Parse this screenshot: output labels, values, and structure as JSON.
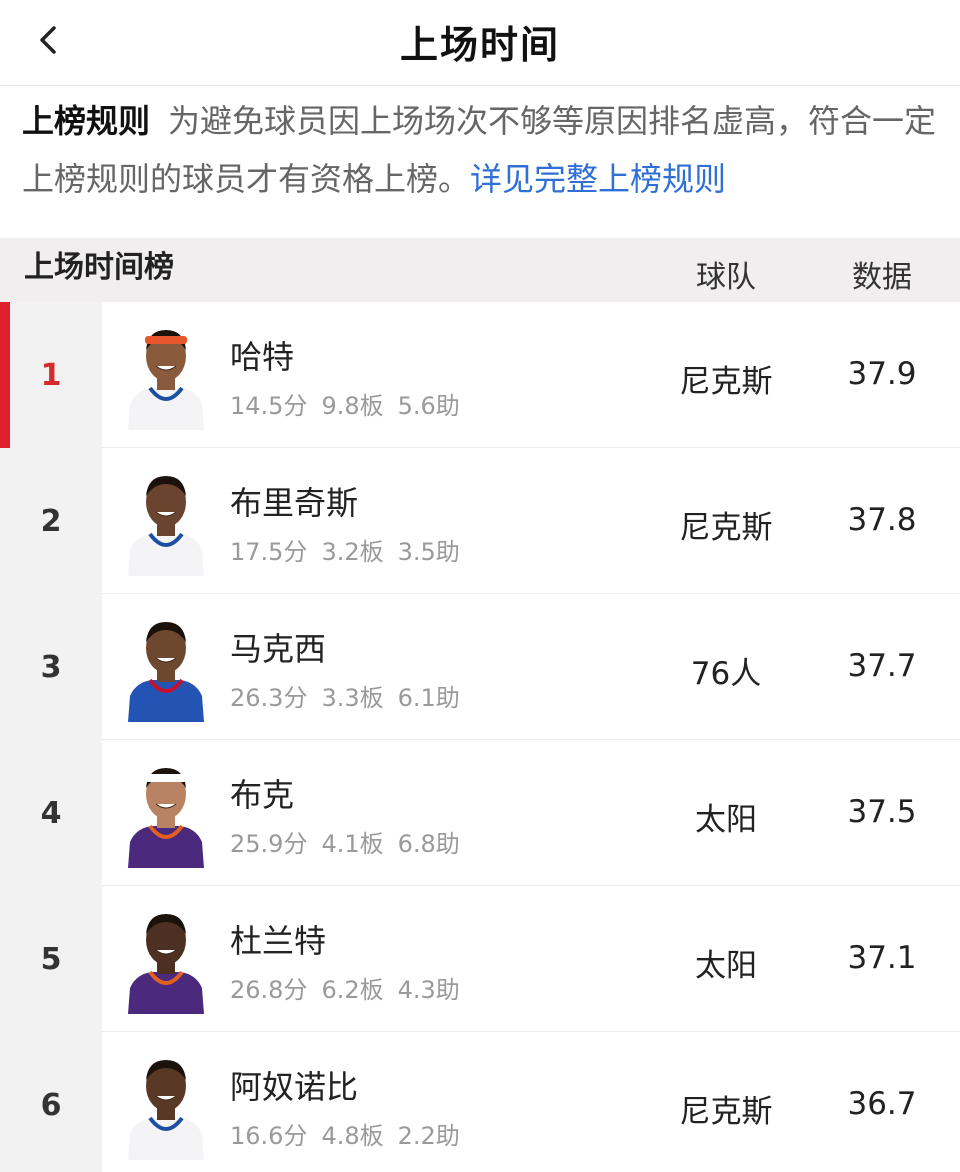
{
  "nav": {
    "title": "上场时间",
    "back_icon": "chevron-left-icon"
  },
  "rules": {
    "heading": "上榜规则",
    "text": "为避免球员因上场场次不够等原因排名虚高，符合一定上榜规则的球员才有资格上榜。",
    "link": "详见完整上榜规则"
  },
  "board": {
    "title": "上场时间榜",
    "col_team": "球队",
    "col_data": "数据"
  },
  "players": [
    {
      "rank": "1",
      "name": "哈特",
      "pts": "14.5分",
      "reb": "9.8板",
      "ast": "5.6助",
      "team": "尼克斯",
      "value": "37.9",
      "headband": "#e8562b",
      "jersey": "#f4f4f7",
      "trim": "#1d4fa1",
      "skin": "#8a5a3c",
      "active": true
    },
    {
      "rank": "2",
      "name": "布里奇斯",
      "pts": "17.5分",
      "reb": "3.2板",
      "ast": "3.5助",
      "team": "尼克斯",
      "value": "37.8",
      "headband": "",
      "jersey": "#f4f4f7",
      "trim": "#1d4fa1",
      "skin": "#6b4430",
      "active": false
    },
    {
      "rank": "3",
      "name": "马克西",
      "pts": "26.3分",
      "reb": "3.3板",
      "ast": "6.1助",
      "team": "76人",
      "value": "37.7",
      "headband": "",
      "jersey": "#2354b4",
      "trim": "#c8102e",
      "skin": "#6e472f",
      "active": false
    },
    {
      "rank": "4",
      "name": "布克",
      "pts": "25.9分",
      "reb": "4.1板",
      "ast": "6.8助",
      "team": "太阳",
      "value": "37.5",
      "headband": "#ffffff",
      "jersey": "#4b2a7d",
      "trim": "#e56020",
      "skin": "#b98363",
      "active": false
    },
    {
      "rank": "5",
      "name": "杜兰特",
      "pts": "26.8分",
      "reb": "6.2板",
      "ast": "4.3助",
      "team": "太阳",
      "value": "37.1",
      "headband": "",
      "jersey": "#4b2a7d",
      "trim": "#e56020",
      "skin": "#4e3022",
      "active": false
    },
    {
      "rank": "6",
      "name": "阿奴诺比",
      "pts": "16.6分",
      "reb": "4.8板",
      "ast": "2.2助",
      "team": "尼克斯",
      "value": "36.7",
      "headband": "",
      "jersey": "#f4f4f7",
      "trim": "#1d4fa1",
      "skin": "#5a3826",
      "active": false
    }
  ]
}
